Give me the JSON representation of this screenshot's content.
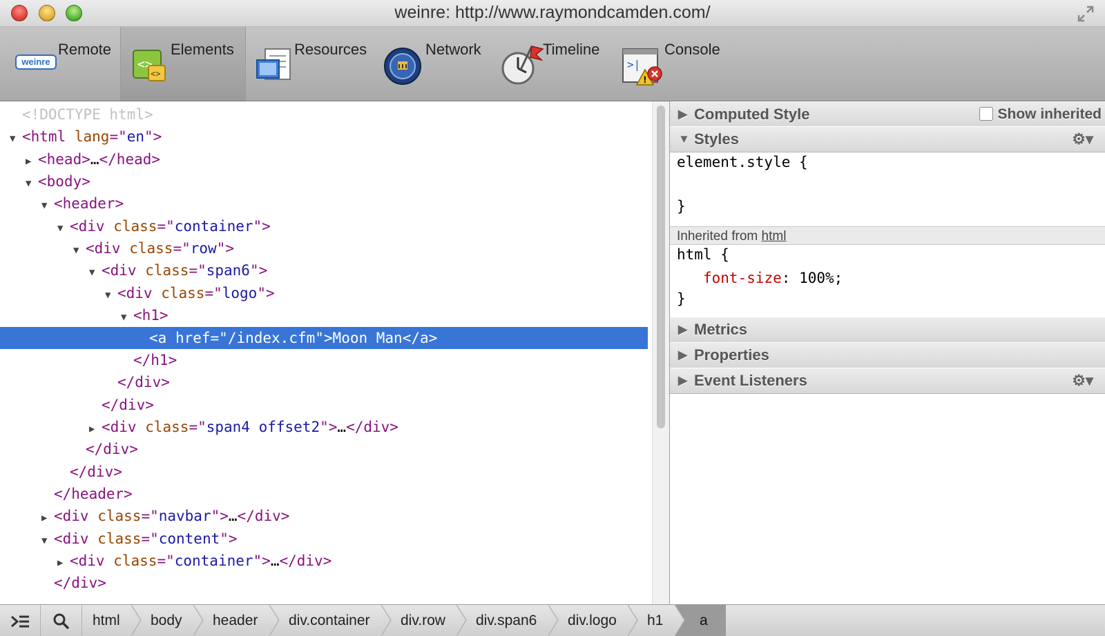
{
  "window": {
    "title": "weinre: http://www.raymondcamden.com/"
  },
  "toolbar": {
    "items": [
      {
        "label": "Remote",
        "icon": "weinre-logo-icon",
        "logo_text": "weinre"
      },
      {
        "label": "Elements",
        "icon": "elements-icon",
        "selected": true
      },
      {
        "label": "Resources",
        "icon": "resources-icon"
      },
      {
        "label": "Network",
        "icon": "network-icon"
      },
      {
        "label": "Timeline",
        "icon": "timeline-icon"
      },
      {
        "label": "Console",
        "icon": "console-icon"
      }
    ]
  },
  "dom_tree": {
    "lines": [
      {
        "indent": 0,
        "tri": "",
        "parts": [
          [
            "doctype",
            "<!DOCTYPE html>"
          ]
        ]
      },
      {
        "indent": 0,
        "tri": "▼",
        "parts": [
          [
            "tag",
            "<html "
          ],
          [
            "attr",
            "lang"
          ],
          [
            "tag",
            "=\""
          ],
          [
            "val",
            "en"
          ],
          [
            "tag",
            "\">"
          ]
        ]
      },
      {
        "indent": 1,
        "tri": "▶",
        "parts": [
          [
            "tag",
            "<head>"
          ],
          [
            "plain",
            "…"
          ],
          [
            "tag",
            "</head>"
          ]
        ]
      },
      {
        "indent": 1,
        "tri": "▼",
        "parts": [
          [
            "tag",
            "<body>"
          ]
        ]
      },
      {
        "indent": 2,
        "tri": "▼",
        "parts": [
          [
            "tag",
            "<header>"
          ]
        ]
      },
      {
        "indent": 3,
        "tri": "▼",
        "parts": [
          [
            "tag",
            "<div "
          ],
          [
            "attr",
            "class"
          ],
          [
            "tag",
            "=\""
          ],
          [
            "val",
            "container"
          ],
          [
            "tag",
            "\">"
          ]
        ]
      },
      {
        "indent": 4,
        "tri": "▼",
        "parts": [
          [
            "tag",
            "<div "
          ],
          [
            "attr",
            "class"
          ],
          [
            "tag",
            "=\""
          ],
          [
            "val",
            "row"
          ],
          [
            "tag",
            "\">"
          ]
        ]
      },
      {
        "indent": 5,
        "tri": "▼",
        "parts": [
          [
            "tag",
            "<div "
          ],
          [
            "attr",
            "class"
          ],
          [
            "tag",
            "=\""
          ],
          [
            "val",
            "span6"
          ],
          [
            "tag",
            "\">"
          ]
        ]
      },
      {
        "indent": 6,
        "tri": "▼",
        "parts": [
          [
            "tag",
            "<div "
          ],
          [
            "attr",
            "class"
          ],
          [
            "tag",
            "=\""
          ],
          [
            "val",
            "logo"
          ],
          [
            "tag",
            "\">"
          ]
        ]
      },
      {
        "indent": 7,
        "tri": "▼",
        "parts": [
          [
            "tag",
            "<h1>"
          ]
        ]
      },
      {
        "indent": 8,
        "tri": "",
        "selected": true,
        "parts": [
          [
            "tag",
            "<a "
          ],
          [
            "attr",
            "href"
          ],
          [
            "tag",
            "=\""
          ],
          [
            "val",
            "/index.cfm"
          ],
          [
            "tag",
            "\">"
          ],
          [
            "plain",
            "Moon Man"
          ],
          [
            "tag",
            "</a>"
          ]
        ]
      },
      {
        "indent": 7,
        "tri": "",
        "parts": [
          [
            "tag",
            "</h1>"
          ]
        ]
      },
      {
        "indent": 6,
        "tri": "",
        "parts": [
          [
            "tag",
            "</div>"
          ]
        ]
      },
      {
        "indent": 5,
        "tri": "",
        "parts": [
          [
            "tag",
            "</div>"
          ]
        ]
      },
      {
        "indent": 5,
        "tri": "▶",
        "parts": [
          [
            "tag",
            "<div "
          ],
          [
            "attr",
            "class"
          ],
          [
            "tag",
            "=\""
          ],
          [
            "val",
            "span4 offset2"
          ],
          [
            "tag",
            "\">"
          ],
          [
            "plain",
            "…"
          ],
          [
            "tag",
            "</div>"
          ]
        ]
      },
      {
        "indent": 4,
        "tri": "",
        "parts": [
          [
            "tag",
            "</div>"
          ]
        ]
      },
      {
        "indent": 3,
        "tri": "",
        "parts": [
          [
            "tag",
            "</div>"
          ]
        ]
      },
      {
        "indent": 2,
        "tri": "",
        "parts": [
          [
            "tag",
            "</header>"
          ]
        ]
      },
      {
        "indent": 2,
        "tri": "▶",
        "parts": [
          [
            "tag",
            "<div "
          ],
          [
            "attr",
            "class"
          ],
          [
            "tag",
            "=\""
          ],
          [
            "val",
            "navbar"
          ],
          [
            "tag",
            "\">"
          ],
          [
            "plain",
            "…"
          ],
          [
            "tag",
            "</div>"
          ]
        ]
      },
      {
        "indent": 2,
        "tri": "▼",
        "parts": [
          [
            "tag",
            "<div "
          ],
          [
            "attr",
            "class"
          ],
          [
            "tag",
            "=\""
          ],
          [
            "val",
            "content"
          ],
          [
            "tag",
            "\">"
          ]
        ]
      },
      {
        "indent": 3,
        "tri": "▶",
        "parts": [
          [
            "tag",
            "<div "
          ],
          [
            "attr",
            "class"
          ],
          [
            "tag",
            "=\""
          ],
          [
            "val",
            "container"
          ],
          [
            "tag",
            "\">"
          ],
          [
            "plain",
            "…"
          ],
          [
            "tag",
            "</div>"
          ]
        ]
      },
      {
        "indent": 2,
        "tri": "",
        "parts": [
          [
            "tag",
            "</div>"
          ]
        ]
      }
    ]
  },
  "side_panel": {
    "computed_style": {
      "title": "Computed Style",
      "show_inherited_label": "Show inherited",
      "show_inherited_checked": false
    },
    "styles": {
      "title": "Styles",
      "element_style_open": "element.style {",
      "element_style_close": "}",
      "inherited_label": "Inherited from",
      "inherited_link": "html",
      "rule_selector_open": "html {",
      "rule_property": "font-size",
      "rule_colon": ":",
      "rule_value": "100%;",
      "rule_close": "}"
    },
    "metrics": {
      "title": "Metrics"
    },
    "properties": {
      "title": "Properties"
    },
    "event_listeners": {
      "title": "Event Listeners"
    }
  },
  "breadcrumbs": {
    "items": [
      "html",
      "body",
      "header",
      "div.container",
      "div.row",
      "div.span6",
      "div.logo",
      "h1",
      "a"
    ],
    "active_index": 8
  },
  "colors": {
    "selection": "#3875d7",
    "tag": "#881280",
    "attr": "#994500",
    "value": "#1a1aa6",
    "css_property": "#c80000"
  }
}
